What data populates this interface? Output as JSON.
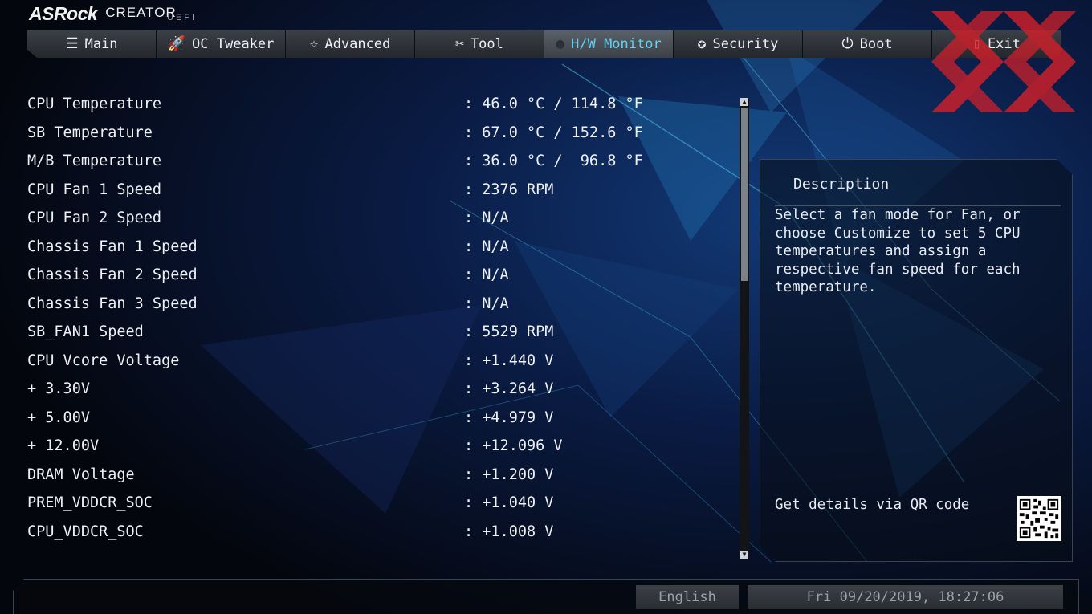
{
  "brand": {
    "name": "ASRock",
    "product": "CREATOR",
    "firmware": "UEFI"
  },
  "tabs": [
    {
      "label": "Main",
      "icon": "list-icon",
      "active": false
    },
    {
      "label": "OC Tweaker",
      "icon": "rocket-icon",
      "active": false
    },
    {
      "label": "Advanced",
      "icon": "star-icon",
      "active": false
    },
    {
      "label": "Tool",
      "icon": "wrench-icon",
      "active": false
    },
    {
      "label": "H/W Monitor",
      "icon": "monitor-icon",
      "active": true
    },
    {
      "label": "Security",
      "icon": "shield-icon",
      "active": false
    },
    {
      "label": "Boot",
      "icon": "power-icon",
      "active": false
    },
    {
      "label": "Exit",
      "icon": "exit-door-icon",
      "active": false
    }
  ],
  "readings": [
    {
      "label": "CPU Temperature",
      "value": ": 46.0 °C / 114.8 °F"
    },
    {
      "label": "SB Temperature",
      "value": ": 67.0 °C / 152.6 °F"
    },
    {
      "label": "M/B Temperature",
      "value": ": 36.0 °C /  96.8 °F"
    },
    {
      "label": "CPU Fan 1 Speed",
      "value": ": 2376 RPM"
    },
    {
      "label": "CPU Fan 2 Speed",
      "value": ": N/A"
    },
    {
      "label": "Chassis Fan 1 Speed",
      "value": ": N/A"
    },
    {
      "label": "Chassis Fan 2 Speed",
      "value": ": N/A"
    },
    {
      "label": "Chassis Fan 3 Speed",
      "value": ": N/A"
    },
    {
      "label": "SB_FAN1 Speed",
      "value": ": 5529 RPM"
    },
    {
      "label": "CPU Vcore Voltage",
      "value": ": +1.440 V"
    },
    {
      "label": "+ 3.30V",
      "value": ": +3.264 V"
    },
    {
      "label": "+ 5.00V",
      "value": ": +4.979 V"
    },
    {
      "label": "+ 12.00V",
      "value": ": +12.096 V"
    },
    {
      "label": "DRAM Voltage",
      "value": ": +1.200 V"
    },
    {
      "label": "PREM_VDDCR_SOC",
      "value": ": +1.040 V"
    },
    {
      "label": "CPU_VDDCR_SOC",
      "value": ": +1.008 V"
    }
  ],
  "description": {
    "title": "Description",
    "text": "Select a fan mode for Fan, or choose Customize to set 5 CPU temperatures and assign a respective fan speed for each temperature.",
    "qr_text": "Get details via QR code"
  },
  "footer": {
    "language": "English",
    "datetime": "Fri 09/20/2019, 18:27:06"
  },
  "colors": {
    "active_tab_text": "#5fd3ef",
    "logo_red": "#d0202a"
  }
}
